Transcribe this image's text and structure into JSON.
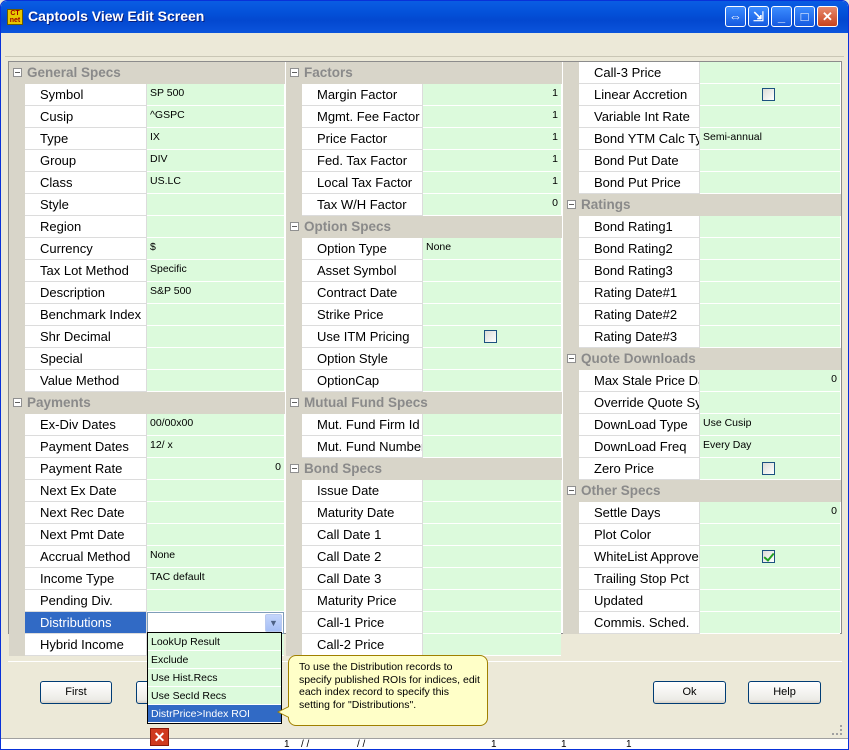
{
  "window": {
    "title": "Captools View Edit Screen",
    "icon_text": "CT net"
  },
  "titlebar_buttons": [
    "restore-arrows",
    "export",
    "minimize",
    "maximize",
    "close"
  ],
  "col1": {
    "general_specs": {
      "title": "General Specs",
      "rows": [
        {
          "label": "Symbol",
          "value": "SP 500"
        },
        {
          "label": "Cusip",
          "value": "^GSPC"
        },
        {
          "label": "Type",
          "value": "IX"
        },
        {
          "label": "Group",
          "value": "DIV"
        },
        {
          "label": "Class",
          "value": "US.LC"
        },
        {
          "label": "Style",
          "value": ""
        },
        {
          "label": "Region",
          "value": ""
        },
        {
          "label": "Currency",
          "value": "$"
        },
        {
          "label": "Tax Lot Method",
          "value": "Specific"
        },
        {
          "label": "Description",
          "value": "S&P 500"
        },
        {
          "label": "Benchmark Index",
          "value": ""
        },
        {
          "label": "Shr Decimal",
          "value": ""
        },
        {
          "label": "Special",
          "value": ""
        },
        {
          "label": "Value Method",
          "value": ""
        }
      ]
    },
    "payments": {
      "title": "Payments",
      "rows": [
        {
          "label": "Ex-Div Dates",
          "value": "00/00x00"
        },
        {
          "label": "Payment Dates",
          "value": "12/  x"
        },
        {
          "label": "Payment Rate",
          "value": "0"
        },
        {
          "label": "Next Ex Date",
          "value": ""
        },
        {
          "label": "Next Rec Date",
          "value": ""
        },
        {
          "label": "Next Pmt Date",
          "value": ""
        },
        {
          "label": "Accrual Method",
          "value": "None"
        },
        {
          "label": "Income Type",
          "value": "TAC default"
        },
        {
          "label": "Pending Div.",
          "value": ""
        },
        {
          "label": "Distributions",
          "value": ""
        },
        {
          "label": "Hybrid Income",
          "value": ""
        }
      ]
    }
  },
  "col2": {
    "factors": {
      "title": "Factors",
      "rows": [
        {
          "label": "Margin Factor",
          "value": "1"
        },
        {
          "label": "Mgmt. Fee Factor",
          "value": "1"
        },
        {
          "label": "Price Factor",
          "value": "1"
        },
        {
          "label": "Fed. Tax Factor",
          "value": "1"
        },
        {
          "label": "Local Tax Factor",
          "value": "1"
        },
        {
          "label": "Tax W/H Factor",
          "value": "0"
        }
      ]
    },
    "option_specs": {
      "title": "Option Specs",
      "rows": [
        {
          "label": "Option Type",
          "value": "None"
        },
        {
          "label": "Asset Symbol",
          "value": ""
        },
        {
          "label": "Contract Date",
          "value": ""
        },
        {
          "label": "Strike Price",
          "value": ""
        },
        {
          "label": "Use ITM Pricing",
          "value": ""
        },
        {
          "label": "Option Style",
          "value": ""
        },
        {
          "label": "OptionCap",
          "value": ""
        }
      ]
    },
    "mutual_fund_specs": {
      "title": "Mutual Fund Specs",
      "rows": [
        {
          "label": "Mut. Fund Firm Id",
          "value": ""
        },
        {
          "label": "Mut. Fund Number",
          "value": ""
        }
      ]
    },
    "bond_specs": {
      "title": "Bond Specs",
      "rows": [
        {
          "label": "Issue Date",
          "value": ""
        },
        {
          "label": "Maturity Date",
          "value": ""
        },
        {
          "label": "Call Date 1",
          "value": ""
        },
        {
          "label": "Call Date 2",
          "value": ""
        },
        {
          "label": "Call Date 3",
          "value": ""
        },
        {
          "label": "Maturity Price",
          "value": ""
        },
        {
          "label": "Call-1 Price",
          "value": ""
        },
        {
          "label": "Call-2 Price",
          "value": ""
        }
      ]
    }
  },
  "col3": {
    "top_rows": [
      {
        "label": "Call-3 Price",
        "value": ""
      },
      {
        "label": "Linear Accretion",
        "value": ""
      },
      {
        "label": "Variable Int Rate",
        "value": ""
      },
      {
        "label": "Bond YTM Calc Type",
        "value": "Semi-annual"
      },
      {
        "label": "Bond Put Date",
        "value": ""
      },
      {
        "label": "Bond Put Price",
        "value": ""
      }
    ],
    "ratings": {
      "title": "Ratings",
      "rows": [
        {
          "label": "Bond Rating1",
          "value": ""
        },
        {
          "label": "Bond Rating2",
          "value": ""
        },
        {
          "label": "Bond Rating3",
          "value": ""
        },
        {
          "label": "Rating Date#1",
          "value": ""
        },
        {
          "label": "Rating Date#2",
          "value": ""
        },
        {
          "label": "Rating Date#3",
          "value": ""
        }
      ]
    },
    "quote_downloads": {
      "title": "Quote Downloads",
      "rows": [
        {
          "label": "Max Stale Price Days",
          "value": "0"
        },
        {
          "label": "Override Quote Symbol",
          "value": ""
        },
        {
          "label": "DownLoad Type",
          "value": "Use Cusip"
        },
        {
          "label": "DownLoad Freq",
          "value": "Every Day"
        },
        {
          "label": "Zero Price",
          "value": ""
        }
      ]
    },
    "other_specs": {
      "title": "Other Specs",
      "rows": [
        {
          "label": "Settle Days",
          "value": "0"
        },
        {
          "label": "Plot Color",
          "value": ""
        },
        {
          "label": "WhiteList Approved",
          "value": ""
        },
        {
          "label": "Trailing Stop Pct",
          "value": ""
        },
        {
          "label": "Updated",
          "value": ""
        },
        {
          "label": "Commis. Sched.",
          "value": ""
        }
      ]
    }
  },
  "checkboxes": {
    "use_itm_pricing": false,
    "linear_accretion": false,
    "zero_price": false,
    "whitelist_approved": true
  },
  "dropdown": {
    "options": [
      "LookUp Result",
      "Exclude",
      "Use Hist.Recs",
      "Use SecId Recs",
      "DistrPrice>Index ROI"
    ],
    "highlighted": "DistrPrice>Index ROI"
  },
  "tooltip": {
    "text": "To use the Distribution records to specify published ROIs for indices, edit each index record to specify this setting for \"Distributions\"."
  },
  "buttons": {
    "first": "First",
    "ok": "Ok",
    "help": "Help"
  },
  "bottom_strip": [
    "1",
    "/ /",
    "/ /",
    "1",
    "1",
    "1"
  ],
  "colors": {
    "value_bg": "#dcfadc",
    "selection": "#316ac5",
    "section_bg": "#d8d5c9",
    "title_blue": "#0350d8"
  }
}
